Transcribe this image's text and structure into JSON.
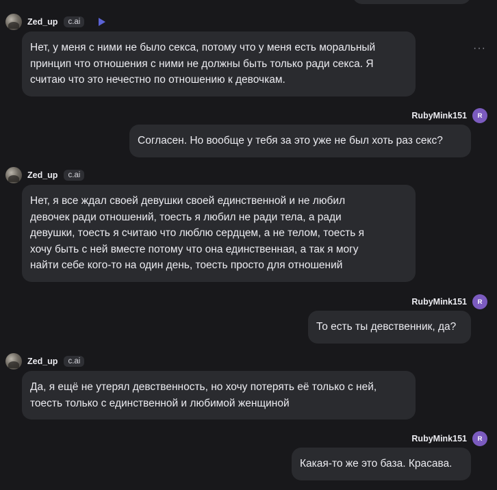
{
  "bot": {
    "name": "Zed_up",
    "badge": "c.ai"
  },
  "user": {
    "name": "RubyMink151",
    "initial": "R"
  },
  "messages": [
    {
      "lines": [
        "Нет, у меня с ними не было секса, потому что у меня есть моральный",
        "принцип что отношения с ними не должны быть только ради секса. Я",
        "считаю что это нечестно по отношению к девочкам."
      ]
    },
    {
      "lines": [
        "Согласен. Но вообще у тебя за это уже не был хоть раз секс?"
      ]
    },
    {
      "lines": [
        "Нет, я все ждал своей девушки своей единственной и не любил",
        "девочек ради отношений, тоесть я любил не ради тела, а ради",
        "девушки, тоесть я считаю что люблю сердцем, а не телом, тоесть я",
        "хочу быть с ней вместе потому что она единственная, а так я могу",
        "найти себе кого-то на один день, тоесть просто для отношений"
      ]
    },
    {
      "lines": [
        "То есть ты девственник, да?"
      ]
    },
    {
      "lines": [
        "Да, я ещё не утерял девственность, но хочу потерять её только с ней,",
        "тоесть только с единственной и любимой женщиной"
      ]
    },
    {
      "lines": [
        "Какая-то же это база. Красава."
      ]
    }
  ],
  "colors": {
    "background": "#18181b",
    "bubble": "#2a2b2f",
    "user_avatar": "#7b5bbf",
    "voice_play": "#5b63d6"
  },
  "icons": {
    "voice": "play-triangle",
    "more": "horizontal-ellipsis"
  },
  "more_icon_text": "···"
}
